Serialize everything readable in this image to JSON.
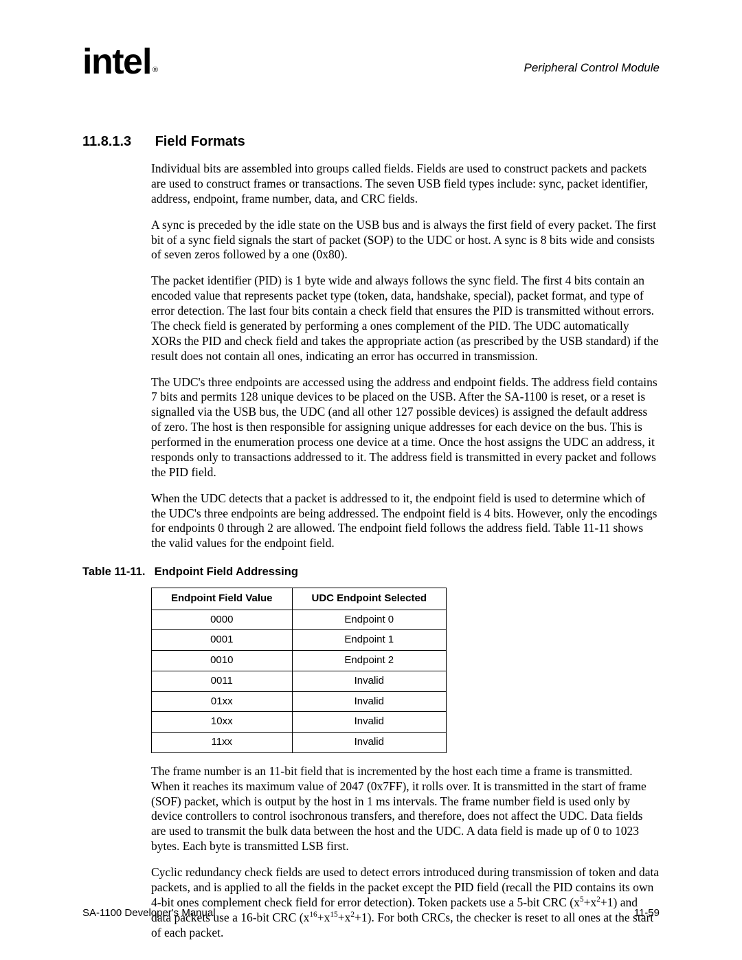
{
  "header": {
    "brand": "intel",
    "right": "Peripheral Control Module"
  },
  "section": {
    "number": "11.8.1.3",
    "title": "Field Formats"
  },
  "paragraphs": {
    "p1": "Individual bits are assembled into groups called fields. Fields are used to construct packets and packets are used to construct frames or transactions. The seven USB field types include: sync, packet identifier, address, endpoint, frame number, data, and CRC fields.",
    "p2": "A sync is preceded by the idle state on the USB bus and is always the first field of every packet. The first bit of a sync field signals the start of packet (SOP) to the UDC or host. A sync is 8 bits wide and consists of seven zeros followed by a one (0x80).",
    "p3": "The packet identifier (PID) is 1 byte wide and always follows the sync field. The first 4 bits contain an encoded value that represents packet type (token, data, handshake, special), packet format, and type of error detection. The last four bits contain a check field that ensures the PID is transmitted without errors. The check field is generated by performing a ones complement of the PID. The UDC automatically XORs the PID and check field and takes the appropriate action (as prescribed by the USB standard) if the result does not contain all ones, indicating an error has occurred in transmission.",
    "p4": "The UDC's three endpoints are accessed using the address and endpoint fields. The address field contains 7 bits and permits 128 unique devices to be placed on the USB. After the SA-1100 is reset, or a reset is signalled via the USB bus, the UDC (and all other 127 possible devices) is assigned the default address of zero. The host is then responsible for assigning unique addresses for each device on the bus. This is performed in the enumeration process one device at a time. Once the host assigns the UDC an address, it  responds only to transactions addressed to it. The address field is transmitted in every packet and follows the PID field.",
    "p5": "When the UDC detects that a packet is addressed to it, the endpoint field is used to determine which of the UDC's three endpoints are being addressed. The endpoint field is 4 bits. However, only the encodings for endpoints 0 through 2 are allowed. The endpoint field follows the address field. Table 11-11 shows the valid values for the endpoint field.",
    "p6": "The frame number is an 11-bit field that is incremented by the host each time a frame is transmitted. When it reaches its maximum value of 2047 (0x7FF), it rolls over. It is transmitted in the start of frame (SOF) packet, which is output by the host in 1 ms intervals. The frame number field is used only by device controllers to control isochronous transfers, and therefore, does not affect the UDC. Data fields are used to transmit the bulk data between the host and the UDC. A data field is made up of 0 to 1023 bytes. Each byte is transmitted LSB first.",
    "p7_before": "Cyclic redundancy check fields are used to detect errors introduced during transmission of token and data packets, and is applied to all the fields in the packet except the PID field (recall the PID contains its own 4-bit ones complement check field for error detection). Token packets use a 5-bit CRC (x",
    "p7_mid1": "+x",
    "p7_mid2": "+1) and data packets use a 16-bit CRC (x",
    "p7_mid3": "+x",
    "p7_mid4": "+x",
    "p7_after": "+1). For both CRCs, the checker is reset to all ones at the start of each packet.",
    "sup5": "5",
    "sup2a": "2",
    "sup16": "16",
    "sup15": "15",
    "sup2b": "2"
  },
  "table": {
    "caption_number": "Table 11-11.",
    "caption_title": "Endpoint Field Addressing",
    "head": {
      "c1": "Endpoint Field Value",
      "c2": "UDC Endpoint Selected"
    },
    "rows": [
      {
        "v": "0000",
        "s": "Endpoint 0"
      },
      {
        "v": "0001",
        "s": "Endpoint 1"
      },
      {
        "v": "0010",
        "s": "Endpoint 2"
      },
      {
        "v": "0011",
        "s": "Invalid"
      },
      {
        "v": "01xx",
        "s": "Invalid"
      },
      {
        "v": "10xx",
        "s": "Invalid"
      },
      {
        "v": "11xx",
        "s": "Invalid"
      }
    ]
  },
  "footer": {
    "left": "SA-1100 Developer's Manual",
    "right": "11-59"
  }
}
